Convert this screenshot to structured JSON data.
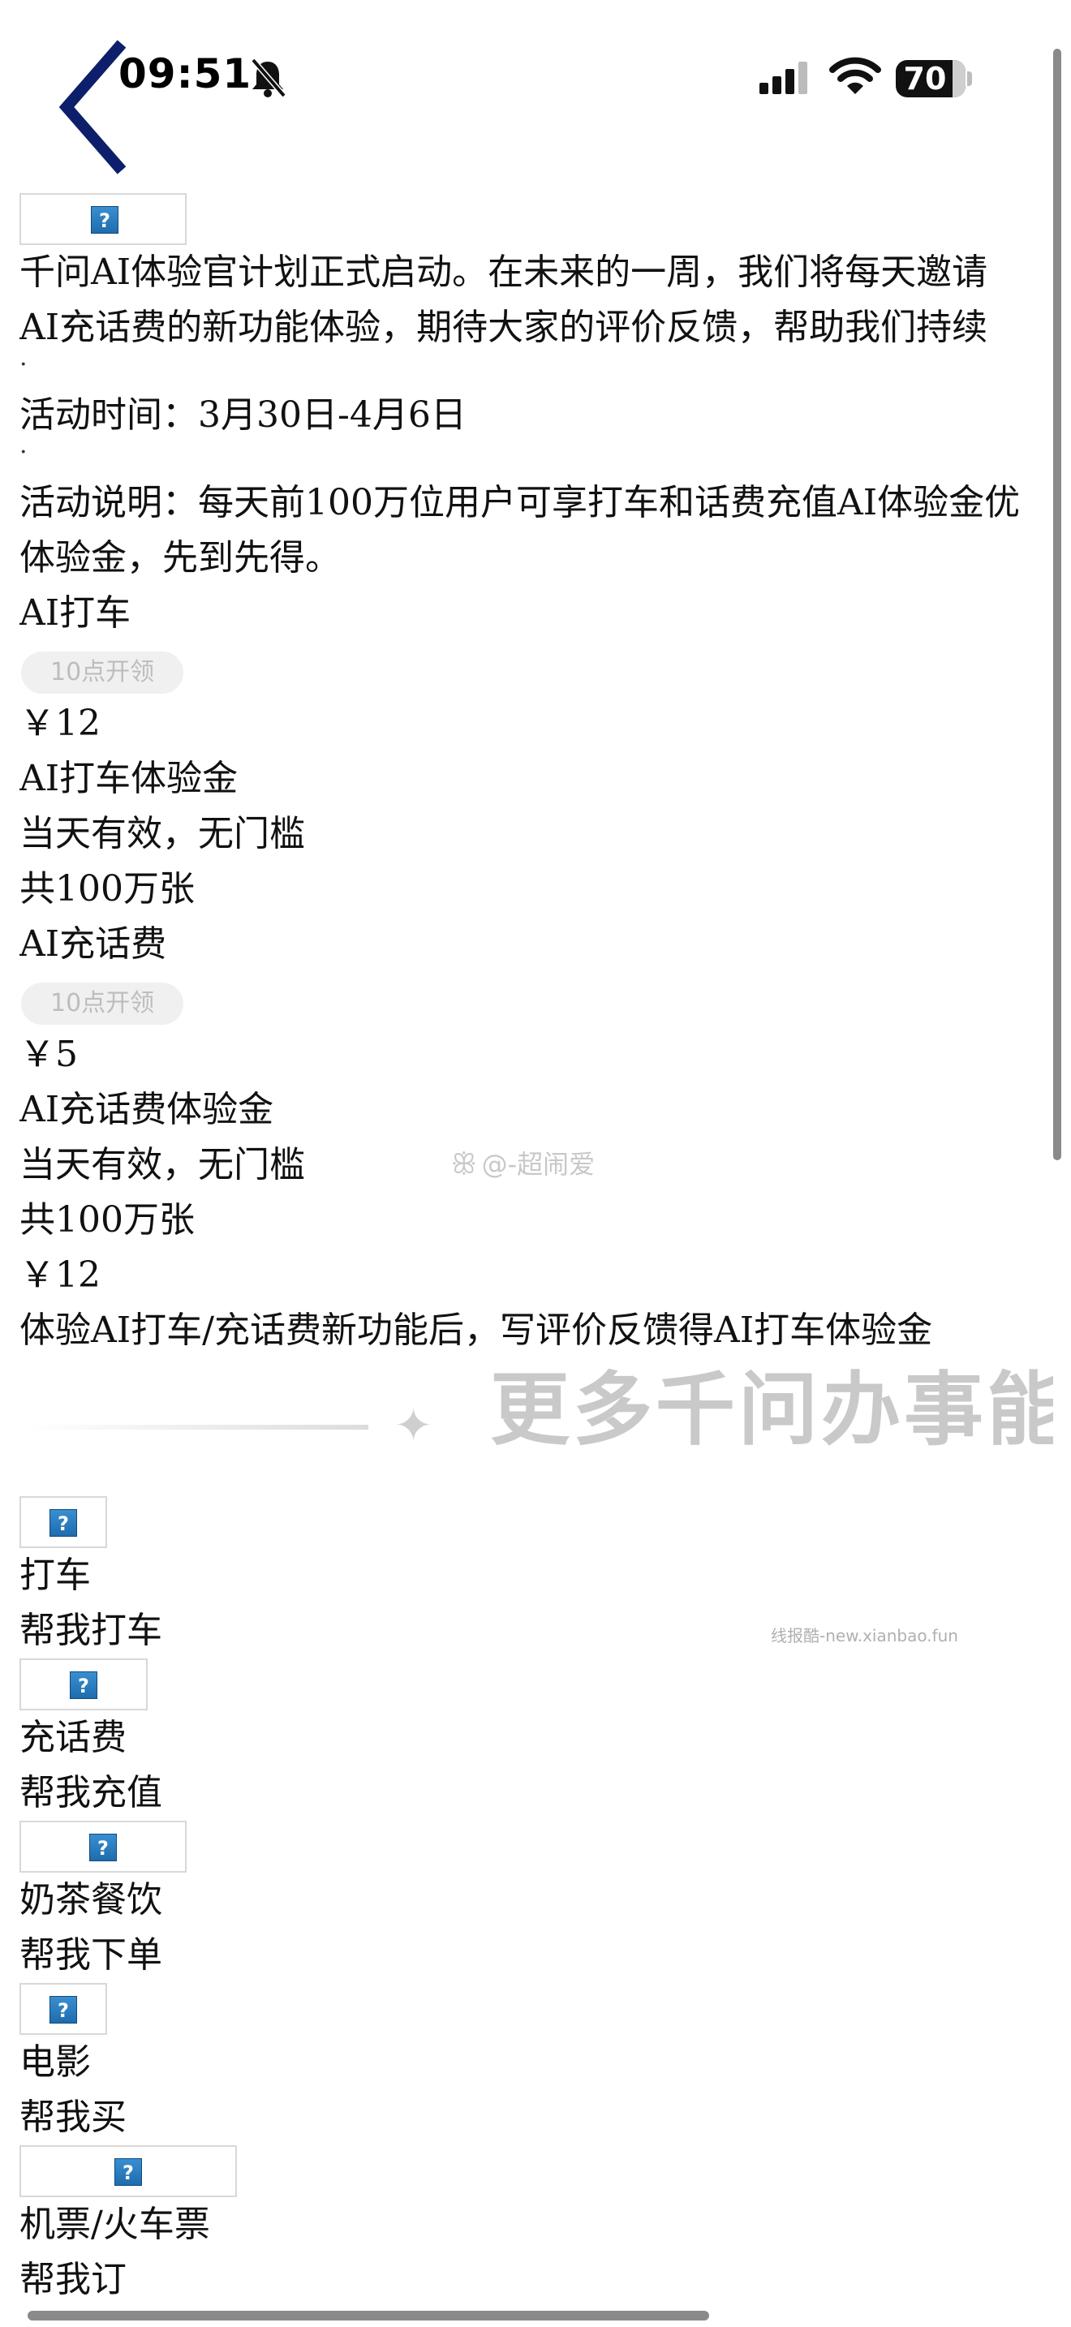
{
  "status_bar": {
    "time": "09:51",
    "battery": "70"
  },
  "announcement": {
    "line1": "千问AI体验官计划正式启动。在未来的一周，我们将每天邀请",
    "line2": "AI充话费的新功能体验，期待大家的评价反馈，帮助我们持续",
    "dot": "·",
    "time_label": "活动时间：3月30日-4月6日",
    "desc_line1": "活动说明：每天前100万位用户可享打车和话费充值AI体验金优",
    "desc_line2": "体验金，先到先得。"
  },
  "coupons": [
    {
      "name": "AI打车",
      "button": "10点开领",
      "price": "￥12",
      "title": "AI打车体验金",
      "validity": "当天有效，无门槛",
      "count": "共100万张"
    },
    {
      "name": "AI充话费",
      "button": "10点开领",
      "price": "￥5",
      "title": "AI充话费体验金",
      "validity": "当天有效，无门槛",
      "count": "共100万张"
    }
  ],
  "review_reward": {
    "price": "￥12",
    "text": "体验AI打车/充话费新功能后，写评价反馈得AI打车体验金"
  },
  "section_divider": {
    "sparkle": "✦",
    "title": "更多千问办事能力"
  },
  "abilities": [
    {
      "name": "打车",
      "action": "帮我打车"
    },
    {
      "name": "充话费",
      "action": "帮我充值"
    },
    {
      "name": "奶茶餐饮",
      "action": "帮我下单"
    },
    {
      "name": "电影",
      "action": "帮我买"
    },
    {
      "name": "机票/火车票",
      "action": "帮我订"
    }
  ],
  "broken_image_glyph": "?",
  "watermarks": {
    "weibo_icon": "ꕥ",
    "weibo": "@-超闹爱",
    "site": "线报酷-new.xianbao.fun"
  },
  "icons": {
    "back": "chevron-left-icon",
    "bell": "bell-slash-icon",
    "signal": "cellular-signal-icon",
    "wifi": "wifi-icon",
    "battery": "battery-icon"
  },
  "colors": {
    "back_chevron": "#0d1f6b",
    "pill_bg": "#f0f0f0",
    "pill_text": "#bdbdbd",
    "broken_image_blue": "#2b7fc4"
  }
}
